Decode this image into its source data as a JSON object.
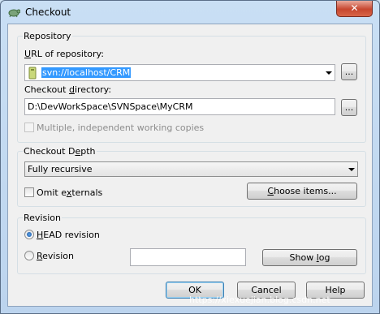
{
  "window": {
    "title": "Checkout",
    "close_glyph": "✕"
  },
  "repository": {
    "group_title": "Repository",
    "url_label": "URL of repository:",
    "url_value": "svn://localhost/CRM",
    "browse_label": "...",
    "dir_label": "Checkout directory:",
    "dir_value": "D:\\DevWorkSpace\\SVNSpace\\MyCRM",
    "dir_browse_label": "...",
    "multiple_label": "Multiple, independent working copies"
  },
  "depth": {
    "group_title": "Checkout Depth",
    "selected": "Fully recursive",
    "omit_externals_label": "Omit externals",
    "choose_items_label": "Choose items..."
  },
  "revision": {
    "group_title": "Revision",
    "head_label": "HEAD revision",
    "revision_label": "Revision",
    "revision_value": "",
    "show_log_label": "Show log"
  },
  "buttons": {
    "ok": "OK",
    "cancel": "Cancel",
    "help": "Help"
  },
  "watermark": "https://xiexuejian.blog.csdn.net",
  "icons": {
    "app": "tortoise-icon",
    "url": "repository-icon",
    "close": "close-icon"
  },
  "colors": {
    "selection": "#3399ff",
    "title_bg": "#bcd4ee",
    "close": "#c7462f"
  }
}
